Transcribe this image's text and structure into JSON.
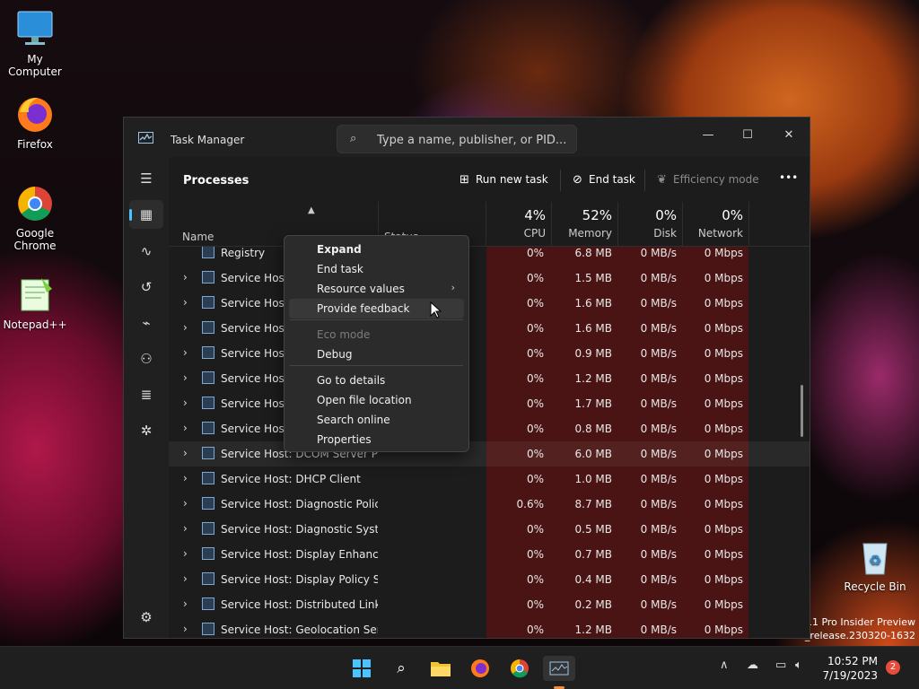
{
  "desktop": {
    "icons": [
      {
        "label": "My Computer"
      },
      {
        "label": "Firefox"
      },
      {
        "label": "Google Chrome"
      },
      {
        "label": "Notepad++"
      },
      {
        "label": "Recycle Bin"
      }
    ],
    "watermark": [
      "11 Pro Insider Preview",
      "n_release.230320-1632"
    ]
  },
  "window": {
    "title": "Task Manager",
    "search_placeholder": "Type a name, publisher, or PID...",
    "controls": {
      "minimize": "—",
      "maximize": "☐",
      "close": "✕"
    }
  },
  "toolbar": {
    "section_title": "Processes",
    "run_new_task": "Run new task",
    "end_task": "End task",
    "efficiency_mode": "Efficiency mode",
    "more": "•••"
  },
  "columns": {
    "name": "Name",
    "status": "Status",
    "cpu": {
      "pct": "4%",
      "label": "CPU"
    },
    "memory": {
      "pct": "52%",
      "label": "Memory"
    },
    "disk": {
      "pct": "0%",
      "label": "Disk"
    },
    "network": {
      "pct": "0%",
      "label": "Network"
    }
  },
  "processes": [
    {
      "name": "Registry",
      "cpu": "0%",
      "memory": "6.8 MB",
      "disk": "0 MB/s",
      "network": "0 Mbps"
    },
    {
      "name": "Service Host: ",
      "cpu": "0%",
      "memory": "1.5 MB",
      "disk": "0 MB/s",
      "network": "0 Mbps"
    },
    {
      "name": "Service Host: ",
      "cpu": "0%",
      "memory": "1.6 MB",
      "disk": "0 MB/s",
      "network": "0 Mbps"
    },
    {
      "name": "Service Host: ",
      "cpu": "0%",
      "memory": "1.6 MB",
      "disk": "0 MB/s",
      "network": "0 Mbps"
    },
    {
      "name": "Service Host: ",
      "cpu": "0%",
      "memory": "0.9 MB",
      "disk": "0 MB/s",
      "network": "0 Mbps"
    },
    {
      "name": "Service Host: ",
      "cpu": "0%",
      "memory": "1.2 MB",
      "disk": "0 MB/s",
      "network": "0 Mbps"
    },
    {
      "name": "Service Host: ",
      "cpu": "0%",
      "memory": "1.7 MB",
      "disk": "0 MB/s",
      "network": "0 Mbps"
    },
    {
      "name": "Service Host: ",
      "cpu": "0%",
      "memory": "0.8 MB",
      "disk": "0 MB/s",
      "network": "0 Mbps"
    },
    {
      "name": "Service Host: DCOM Server Pr...",
      "cpu": "0%",
      "memory": "6.0 MB",
      "disk": "0 MB/s",
      "network": "0 Mbps"
    },
    {
      "name": "Service Host: DHCP Client",
      "cpu": "0%",
      "memory": "1.0 MB",
      "disk": "0 MB/s",
      "network": "0 Mbps"
    },
    {
      "name": "Service Host: Diagnostic Polic...",
      "cpu": "0.6%",
      "memory": "8.7 MB",
      "disk": "0 MB/s",
      "network": "0 Mbps"
    },
    {
      "name": "Service Host: Diagnostic Syste...",
      "cpu": "0%",
      "memory": "0.5 MB",
      "disk": "0 MB/s",
      "network": "0 Mbps"
    },
    {
      "name": "Service Host: Display Enhance...",
      "cpu": "0%",
      "memory": "0.7 MB",
      "disk": "0 MB/s",
      "network": "0 Mbps"
    },
    {
      "name": "Service Host: Display Policy Se...",
      "cpu": "0%",
      "memory": "0.4 MB",
      "disk": "0 MB/s",
      "network": "0 Mbps"
    },
    {
      "name": "Service Host: Distributed Link ...",
      "cpu": "0%",
      "memory": "0.2 MB",
      "disk": "0 MB/s",
      "network": "0 Mbps"
    },
    {
      "name": "Service Host: Geolocation Serv...",
      "cpu": "0%",
      "memory": "1.2 MB",
      "disk": "0 MB/s",
      "network": "0 Mbps"
    }
  ],
  "context_menu": {
    "items": [
      {
        "label": "Expand"
      },
      {
        "label": "End task"
      },
      {
        "label": "Resource values"
      },
      {
        "label": "Provide feedback"
      },
      {
        "label": "Eco mode"
      },
      {
        "label": "Debug"
      },
      {
        "label": "Go to details"
      },
      {
        "label": "Open file location"
      },
      {
        "label": "Search online"
      },
      {
        "label": "Properties"
      }
    ],
    "submenu_arrow": "›"
  },
  "taskbar": {
    "clock_time": "10:52 PM",
    "clock_date": "7/19/2023",
    "notification_count": "2"
  },
  "colors": {
    "accent": "#4cc2ff",
    "heat": "#4a1414",
    "window_bg": "#1c1c1c"
  }
}
